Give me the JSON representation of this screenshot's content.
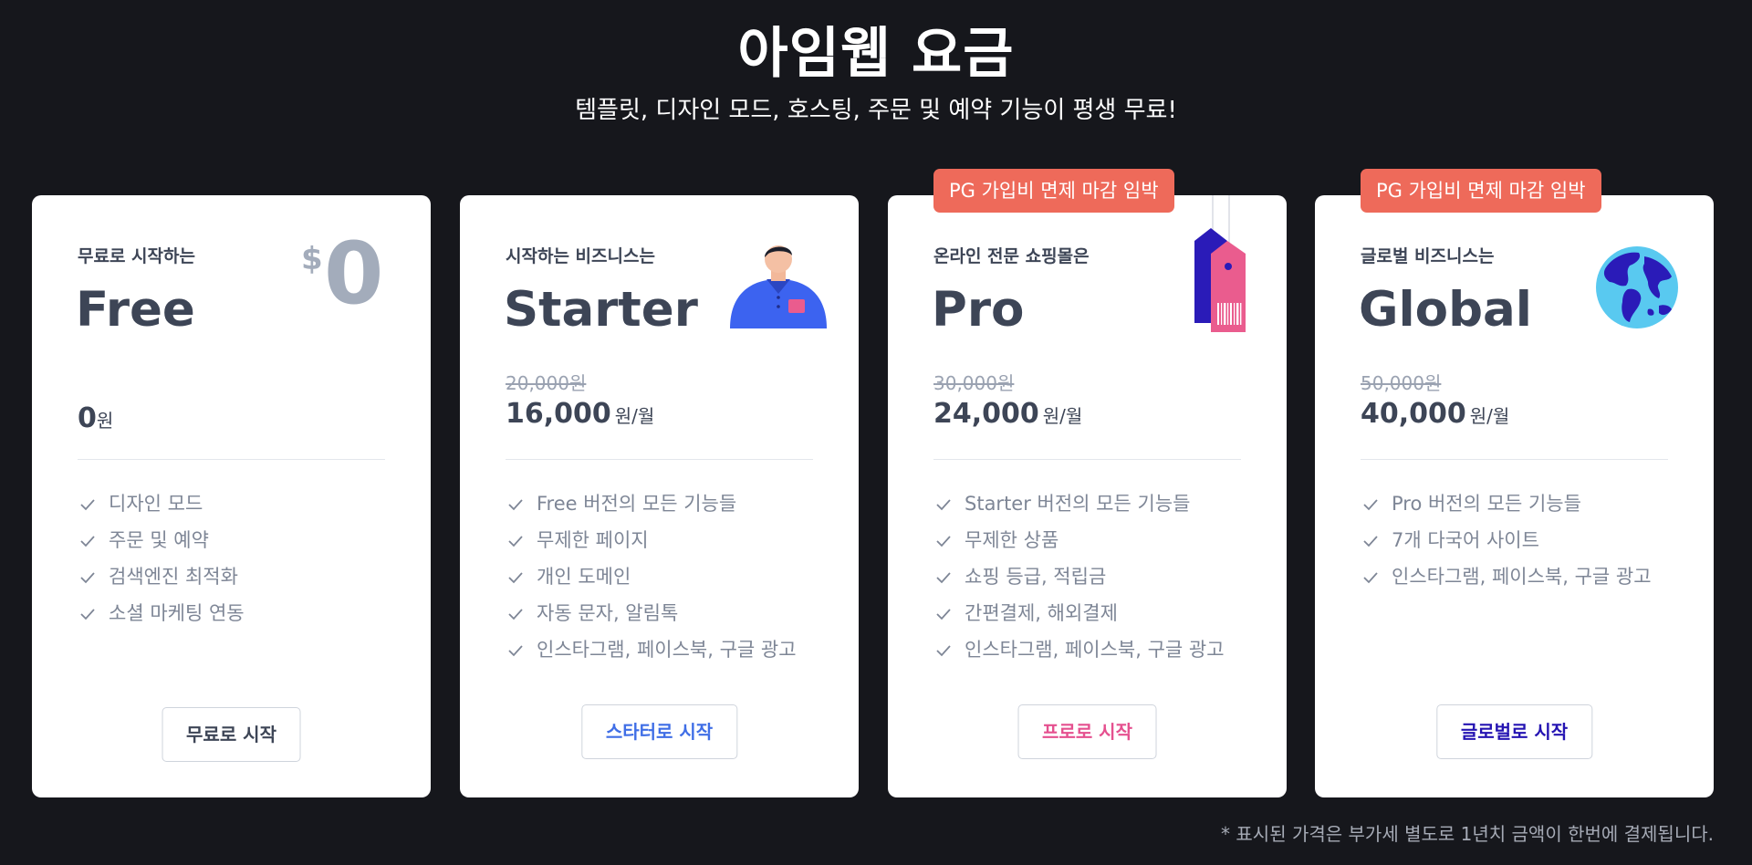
{
  "header": {
    "title": "아임웹 요금",
    "subtitle": "템플릿, 디자인 모드, 호스팅, 주문 및 예약 기능이 평생 무료!"
  },
  "colors": {
    "background": "#16171c",
    "card": "#ffffff",
    "badge": "#ee6a5a",
    "starter_accent": "#3f6ee6",
    "pro_accent": "#e5508f",
    "global_accent": "#2413b2"
  },
  "plans": [
    {
      "tagline": "무료로 시작하는",
      "name": "Free",
      "currency_symbol": "$",
      "hero_price": "0",
      "price": "0",
      "price_unit": "원",
      "features": [
        "디자인 모드",
        "주문 및 예약",
        "검색엔진 최적화",
        "소셜 마케팅 연동"
      ],
      "cta": "무료로 시작"
    },
    {
      "tagline": "시작하는 비즈니스는",
      "name": "Starter",
      "icon": "person-icon",
      "old_price": "20,000원",
      "price": "16,000",
      "price_unit": "원/월",
      "features": [
        "Free 버전의 모든 기능들",
        "무제한 페이지",
        "개인 도메인",
        "자동 문자, 알림톡",
        "인스타그램, 페이스북, 구글 광고"
      ],
      "cta": "스타터로 시작"
    },
    {
      "badge": "PG 가입비 면제 마감 임박",
      "tagline": "온라인 전문 쇼핑몰은",
      "name": "Pro",
      "icon": "price-tag-icon",
      "old_price": "30,000원",
      "price": "24,000",
      "price_unit": "원/월",
      "features": [
        "Starter 버전의 모든 기능들",
        "무제한 상품",
        "쇼핑 등급, 적립금",
        "간편결제, 해외결제",
        "인스타그램, 페이스북, 구글 광고"
      ],
      "cta": "프로로 시작"
    },
    {
      "badge": "PG 가입비 면제 마감 임박",
      "tagline": "글로벌 비즈니스는",
      "name": "Global",
      "icon": "globe-icon",
      "old_price": "50,000원",
      "price": "40,000",
      "price_unit": "원/월",
      "features": [
        "Pro 버전의 모든 기능들",
        "7개 다국어 사이트",
        "인스타그램, 페이스북, 구글 광고"
      ],
      "cta": "글로벌로 시작"
    }
  ],
  "footnote": "* 표시된 가격은 부가세 별도로 1년치 금액이 한번에 결제됩니다."
}
